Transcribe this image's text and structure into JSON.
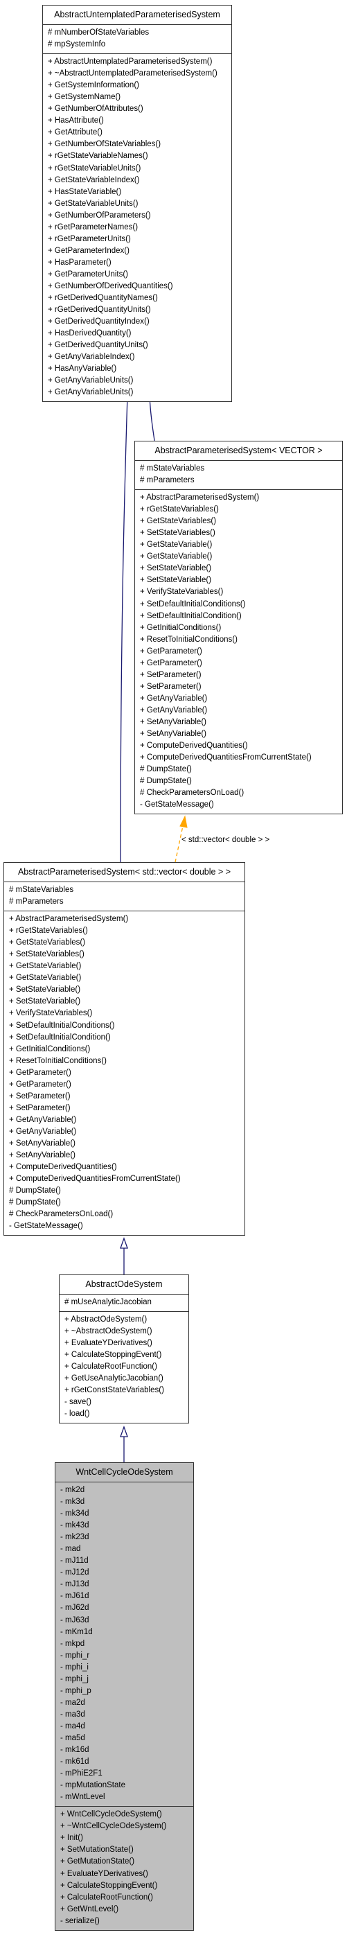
{
  "diagram": {
    "type": "uml-class-inheritance",
    "classes": [
      {
        "id": "aups",
        "name": "AbstractUntemplatedParameterisedSystem",
        "highlighted": false,
        "attributes": [
          "# mNumberOfStateVariables",
          "# mpSystemInfo"
        ],
        "operations": [
          "+ AbstractUntemplatedParameterisedSystem()",
          "+ ~AbstractUntemplatedParameterisedSystem()",
          "+ GetSystemInformation()",
          "+ GetSystemName()",
          "+ GetNumberOfAttributes()",
          "+ HasAttribute()",
          "+ GetAttribute()",
          "+ GetNumberOfStateVariables()",
          "+ rGetStateVariableNames()",
          "+ rGetStateVariableUnits()",
          "+ GetStateVariableIndex()",
          "+ HasStateVariable()",
          "+ GetStateVariableUnits()",
          "+ GetNumberOfParameters()",
          "+ rGetParameterNames()",
          "+ rGetParameterUnits()",
          "+ GetParameterIndex()",
          "+ HasParameter()",
          "+ GetParameterUnits()",
          "+ GetNumberOfDerivedQuantities()",
          "+ rGetDerivedQuantityNames()",
          "+ rGetDerivedQuantityUnits()",
          "+ GetDerivedQuantityIndex()",
          "+ HasDerivedQuantity()",
          "+ GetDerivedQuantityUnits()",
          "+ GetAnyVariableIndex()",
          "+ HasAnyVariable()",
          "+ GetAnyVariableUnits()",
          "+ GetAnyVariableUnits()"
        ]
      },
      {
        "id": "aps_vector",
        "name": "AbstractParameterisedSystem< VECTOR >",
        "highlighted": false,
        "attributes": [
          "# mStateVariables",
          "# mParameters"
        ],
        "operations": [
          "+ AbstractParameterisedSystem()",
          "+ rGetStateVariables()",
          "+ GetStateVariables()",
          "+ SetStateVariables()",
          "+ GetStateVariable()",
          "+ GetStateVariable()",
          "+ SetStateVariable()",
          "+ SetStateVariable()",
          "+ VerifyStateVariables()",
          "+ SetDefaultInitialConditions()",
          "+ SetDefaultInitialCondition()",
          "+ GetInitialConditions()",
          "+ ResetToInitialConditions()",
          "+ GetParameter()",
          "+ GetParameter()",
          "+ SetParameter()",
          "+ SetParameter()",
          "+ GetAnyVariable()",
          "+ GetAnyVariable()",
          "+ SetAnyVariable()",
          "+ SetAnyVariable()",
          "+ ComputeDerivedQuantities()",
          "+ ComputeDerivedQuantitiesFromCurrentState()",
          "# DumpState()",
          "# DumpState()",
          "# CheckParametersOnLoad()",
          "- GetStateMessage()"
        ]
      },
      {
        "id": "aps_stdvec",
        "name": "AbstractParameterisedSystem< std::vector< double > >",
        "highlighted": false,
        "attributes": [
          "# mStateVariables",
          "# mParameters"
        ],
        "operations": [
          "+ AbstractParameterisedSystem()",
          "+ rGetStateVariables()",
          "+ GetStateVariables()",
          "+ SetStateVariables()",
          "+ GetStateVariable()",
          "+ GetStateVariable()",
          "+ SetStateVariable()",
          "+ SetStateVariable()",
          "+ VerifyStateVariables()",
          "+ SetDefaultInitialConditions()",
          "+ SetDefaultInitialCondition()",
          "+ GetInitialConditions()",
          "+ ResetToInitialConditions()",
          "+ GetParameter()",
          "+ GetParameter()",
          "+ SetParameter()",
          "+ SetParameter()",
          "+ GetAnyVariable()",
          "+ GetAnyVariable()",
          "+ SetAnyVariable()",
          "+ SetAnyVariable()",
          "+ ComputeDerivedQuantities()",
          "+ ComputeDerivedQuantitiesFromCurrentState()",
          "# DumpState()",
          "# DumpState()",
          "# CheckParametersOnLoad()",
          "- GetStateMessage()"
        ]
      },
      {
        "id": "aode",
        "name": "AbstractOdeSystem",
        "highlighted": false,
        "attributes": [
          "# mUseAnalyticJacobian"
        ],
        "operations": [
          "+ AbstractOdeSystem()",
          "+ ~AbstractOdeSystem()",
          "+ EvaluateYDerivatives()",
          "+ CalculateStoppingEvent()",
          "+ CalculateRootFunction()",
          "+ GetUseAnalyticJacobian()",
          "+ rGetConstStateVariables()",
          "- save()",
          "- load()"
        ]
      },
      {
        "id": "wnt",
        "name": "WntCellCycleOdeSystem",
        "highlighted": true,
        "attributes": [
          "- mk2d",
          "- mk3d",
          "- mk34d",
          "- mk43d",
          "- mk23d",
          "- mad",
          "- mJ11d",
          "- mJ12d",
          "- mJ13d",
          "- mJ61d",
          "- mJ62d",
          "- mJ63d",
          "- mKm1d",
          "- mkpd",
          "- mphi_r",
          "- mphi_i",
          "- mphi_j",
          "- mphi_p",
          "- ma2d",
          "- ma3d",
          "- ma4d",
          "- ma5d",
          "- mk16d",
          "- mk61d",
          "- mPhiE2F1",
          "- mpMutationState",
          "- mWntLevel"
        ],
        "operations": [
          "+ WntCellCycleOdeSystem()",
          "+ ~WntCellCycleOdeSystem()",
          "+ Init()",
          "+ SetMutationState()",
          "+ GetMutationState()",
          "+ EvaluateYDerivatives()",
          "+ CalculateStoppingEvent()",
          "+ CalculateRootFunction()",
          "+ GetWntLevel()",
          "- serialize()"
        ]
      }
    ],
    "edges": [
      {
        "from": "aps_vector",
        "to": "aups",
        "kind": "inheritance",
        "color": "#191970"
      },
      {
        "from": "aps_stdvec",
        "to": "aups",
        "kind": "inheritance",
        "color": "#191970"
      },
      {
        "from": "aps_stdvec",
        "to": "aps_vector",
        "kind": "template-instantiation",
        "color": "#ffa500",
        "label": "< std::vector< double > >"
      },
      {
        "from": "aode",
        "to": "aps_stdvec",
        "kind": "inheritance",
        "color": "#191970"
      },
      {
        "from": "wnt",
        "to": "aode",
        "kind": "inheritance",
        "color": "#191970"
      }
    ]
  }
}
